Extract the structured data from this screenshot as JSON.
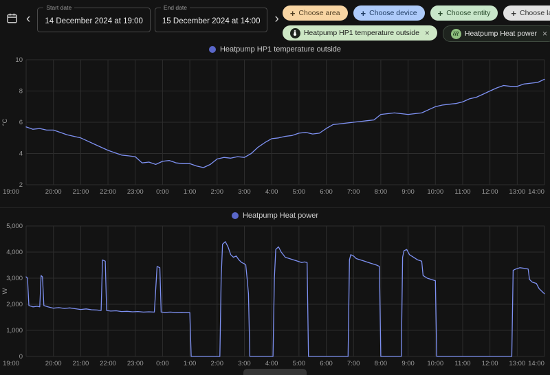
{
  "theme": {
    "page_bg": "#131313",
    "grid": "#2d2d2d",
    "axis_text": "#9c9c9c",
    "legend_text": "#cfcfcf"
  },
  "header": {
    "start_label": "Start date",
    "start_value": "14 December 2024 at 19:00",
    "end_label": "End date",
    "end_value": "15 December 2024 at 14:00",
    "prev_icon": "‹",
    "next_icon": "›"
  },
  "filters": {
    "choose_chips": [
      {
        "label": "Choose area",
        "bg": "#f8d5a3",
        "fg": "#4f3d22"
      },
      {
        "label": "Choose device",
        "bg": "#aecbfa",
        "fg": "#1f3c63"
      },
      {
        "label": "Choose entity",
        "bg": "#c8e6c9",
        "fg": "#27492b"
      },
      {
        "label": "Choose label",
        "bg": "#e2e2e2",
        "fg": "#333333"
      }
    ],
    "selected_chips": [
      {
        "label": "Heatpump HP1 temperature outside",
        "bg": "#cde7c5",
        "fg": "#1c1c1c",
        "icon": "thermometer-icon",
        "icon_bg": "#1d241d",
        "close": "×"
      },
      {
        "label": "Heatpump Heat power",
        "bg": "#1e231e",
        "fg": "#e6e6e6",
        "icon": "heat-wave-icon",
        "icon_bg": "#8fbf7f",
        "border": "#3f4a3f",
        "close": "×"
      }
    ]
  },
  "chart_data": [
    {
      "type": "line",
      "title": "Heatpump HP1 temperature outside",
      "ylabel": "°C",
      "ylim": [
        2,
        10
      ],
      "ytick_values": [
        2,
        4,
        6,
        8,
        10
      ],
      "ytick_labels": [
        "2",
        "4",
        "6",
        "8",
        "10"
      ],
      "x_span_hours": 19,
      "x_tick_labels": [
        "19:00",
        "20:00",
        "21:00",
        "22:00",
        "23:00",
        "0:00",
        "1:00",
        "2:00",
        "3:00",
        "4:00",
        "5:00",
        "6:00",
        "7:00",
        "8:00",
        "9:00",
        "10:00",
        "11:00",
        "12:00",
        "13:00",
        "14:00"
      ],
      "start_h": 0,
      "step_h": 0.25,
      "values": [
        5.7,
        5.55,
        5.6,
        5.5,
        5.5,
        5.35,
        5.2,
        5.1,
        5.0,
        4.8,
        4.6,
        4.4,
        4.2,
        4.05,
        3.9,
        3.85,
        3.8,
        3.4,
        3.45,
        3.3,
        3.5,
        3.55,
        3.4,
        3.35,
        3.35,
        3.2,
        3.1,
        3.3,
        3.65,
        3.75,
        3.7,
        3.8,
        3.75,
        4.0,
        4.4,
        4.7,
        4.95,
        5.0,
        5.1,
        5.15,
        5.3,
        5.35,
        5.25,
        5.3,
        5.6,
        5.85,
        5.9,
        5.95,
        6.0,
        6.05,
        6.1,
        6.15,
        6.5,
        6.55,
        6.6,
        6.55,
        6.5,
        6.55,
        6.6,
        6.8,
        7.0,
        7.1,
        7.15,
        7.2,
        7.3,
        7.5,
        7.6,
        7.8,
        8.0,
        8.2,
        8.35,
        8.3,
        8.3,
        8.45,
        8.5,
        8.55,
        8.75
      ],
      "line_color": "#7e91f2",
      "legend_dot_color": "#5a67c9",
      "grid": true,
      "legend_position": "top-center"
    },
    {
      "type": "line",
      "title": "Heatpump Heat power",
      "ylabel": "W",
      "ylim": [
        0,
        5000
      ],
      "ytick_values": [
        0,
        1000,
        2000,
        3000,
        4000,
        5000
      ],
      "ytick_labels": [
        "0",
        "1,000",
        "2,000",
        "3,000",
        "4,000",
        "5,000"
      ],
      "x_span_hours": 19,
      "x_tick_labels": [
        "19:00",
        "20:00",
        "21:00",
        "22:00",
        "23:00",
        "0:00",
        "1:00",
        "2:00",
        "3:00",
        "4:00",
        "5:00",
        "6:00",
        "7:00",
        "8:00",
        "9:00",
        "10:00",
        "11:00",
        "12:00",
        "13:00",
        "14:00"
      ],
      "points": [
        [
          0,
          3050
        ],
        [
          0.05,
          3000
        ],
        [
          0.1,
          1950
        ],
        [
          0.25,
          1900
        ],
        [
          0.4,
          1920
        ],
        [
          0.5,
          1900
        ],
        [
          0.55,
          3100
        ],
        [
          0.6,
          3050
        ],
        [
          0.65,
          1950
        ],
        [
          0.8,
          1900
        ],
        [
          1,
          1850
        ],
        [
          1.2,
          1870
        ],
        [
          1.4,
          1840
        ],
        [
          1.6,
          1860
        ],
        [
          1.8,
          1830
        ],
        [
          2,
          1800
        ],
        [
          2.2,
          1820
        ],
        [
          2.4,
          1790
        ],
        [
          2.6,
          1780
        ],
        [
          2.75,
          1760
        ],
        [
          2.8,
          3700
        ],
        [
          2.9,
          3650
        ],
        [
          2.95,
          1760
        ],
        [
          3.1,
          1740
        ],
        [
          3.3,
          1750
        ],
        [
          3.5,
          1720
        ],
        [
          3.7,
          1730
        ],
        [
          3.9,
          1710
        ],
        [
          4.1,
          1720
        ],
        [
          4.3,
          1700
        ],
        [
          4.5,
          1710
        ],
        [
          4.7,
          1700
        ],
        [
          4.8,
          3450
        ],
        [
          4.9,
          3400
        ],
        [
          4.95,
          1700
        ],
        [
          5.1,
          1690
        ],
        [
          5.3,
          1700
        ],
        [
          5.5,
          1680
        ],
        [
          5.7,
          1690
        ],
        [
          5.9,
          1680
        ],
        [
          6,
          1680
        ],
        [
          6.05,
          0
        ],
        [
          7.1,
          0
        ],
        [
          7.15,
          3000
        ],
        [
          7.2,
          4300
        ],
        [
          7.3,
          4400
        ],
        [
          7.4,
          4200
        ],
        [
          7.5,
          3900
        ],
        [
          7.6,
          3800
        ],
        [
          7.7,
          3850
        ],
        [
          7.8,
          3700
        ],
        [
          7.9,
          3600
        ],
        [
          8,
          3550
        ],
        [
          8.05,
          3500
        ],
        [
          8.1,
          3000
        ],
        [
          8.15,
          2400
        ],
        [
          8.2,
          0
        ],
        [
          9.05,
          0
        ],
        [
          9.1,
          3000
        ],
        [
          9.15,
          4100
        ],
        [
          9.25,
          4200
        ],
        [
          9.35,
          4000
        ],
        [
          9.5,
          3800
        ],
        [
          9.65,
          3750
        ],
        [
          9.8,
          3700
        ],
        [
          9.95,
          3650
        ],
        [
          10.1,
          3600
        ],
        [
          10.2,
          3620
        ],
        [
          10.3,
          3600
        ],
        [
          10.35,
          0
        ],
        [
          11.8,
          0
        ],
        [
          11.85,
          3700
        ],
        [
          11.9,
          3900
        ],
        [
          12,
          3850
        ],
        [
          12.1,
          3750
        ],
        [
          12.25,
          3700
        ],
        [
          12.4,
          3650
        ],
        [
          12.55,
          3600
        ],
        [
          12.7,
          3550
        ],
        [
          12.85,
          3500
        ],
        [
          12.95,
          3450
        ],
        [
          13,
          0
        ],
        [
          13.75,
          0
        ],
        [
          13.8,
          3800
        ],
        [
          13.85,
          4050
        ],
        [
          13.95,
          4100
        ],
        [
          14.05,
          3900
        ],
        [
          14.2,
          3800
        ],
        [
          14.35,
          3700
        ],
        [
          14.5,
          3650
        ],
        [
          14.55,
          3100
        ],
        [
          14.7,
          3000
        ],
        [
          14.85,
          2950
        ],
        [
          15,
          2900
        ],
        [
          15.05,
          0
        ],
        [
          17.8,
          0
        ],
        [
          17.85,
          3300
        ],
        [
          17.95,
          3350
        ],
        [
          18.1,
          3400
        ],
        [
          18.25,
          3380
        ],
        [
          18.4,
          3350
        ],
        [
          18.45,
          2950
        ],
        [
          18.55,
          2850
        ],
        [
          18.7,
          2800
        ],
        [
          18.8,
          2600
        ],
        [
          18.9,
          2500
        ],
        [
          19,
          2400
        ]
      ],
      "line_color": "#7e91f2",
      "legend_dot_color": "#5a67c9",
      "grid": true,
      "legend_position": "top-center"
    }
  ]
}
